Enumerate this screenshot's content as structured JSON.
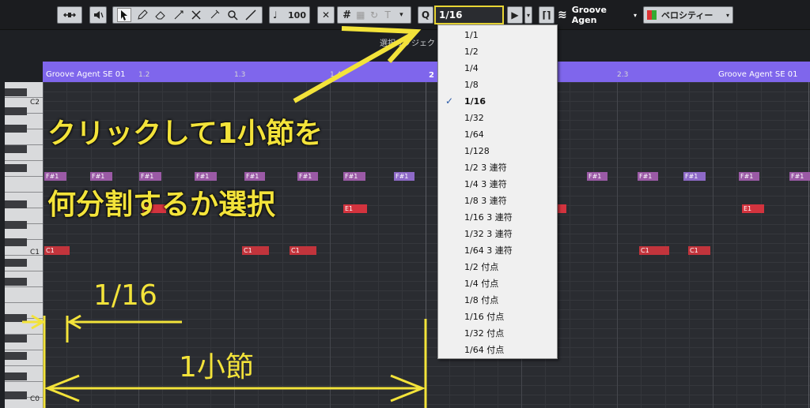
{
  "toolbar": {
    "velocity_value": "100",
    "quantize_label": "Q",
    "quantize_value": "1/16",
    "instrument_label": "Groove Agen",
    "controller_label": "ベロシティー",
    "obscured_text": "選択オブジェク"
  },
  "ruler": {
    "part_name_left": "Groove Agent SE 01",
    "part_name_right": "Groove Agent SE 01",
    "ticks": [
      "1.2",
      "1.3",
      "1.4",
      "2",
      "2.3"
    ]
  },
  "keys": {
    "c2": "C2",
    "c1": "C1",
    "c0": "C0"
  },
  "notes": {
    "fs": "F#1",
    "e1": "E1",
    "c1": "C1"
  },
  "quantize_menu": {
    "items": [
      "1/1",
      "1/2",
      "1/4",
      "1/8",
      "1/16",
      "1/32",
      "1/64",
      "1/128",
      "1/2  3 連符",
      "1/4  3 連符",
      "1/8  3 連符",
      "1/16  3 連符",
      "1/32  3 連符",
      "1/64  3 連符",
      "1/2  付点",
      "1/4  付点",
      "1/8  付点",
      "1/16  付点",
      "1/32  付点",
      "1/64  付点"
    ],
    "selected": "1/16",
    "check_mark": "✓"
  },
  "annotations": {
    "line1": "クリックして1小節を",
    "line2": "何分割するか選択",
    "sixteenth": "1/16",
    "one_bar": "1小節"
  },
  "colors": {
    "annotation_yellow": "#f3e33a",
    "part_purple": "#7f66ec",
    "note_red": "#d3333e",
    "note_fs": "#9b5aa6"
  }
}
